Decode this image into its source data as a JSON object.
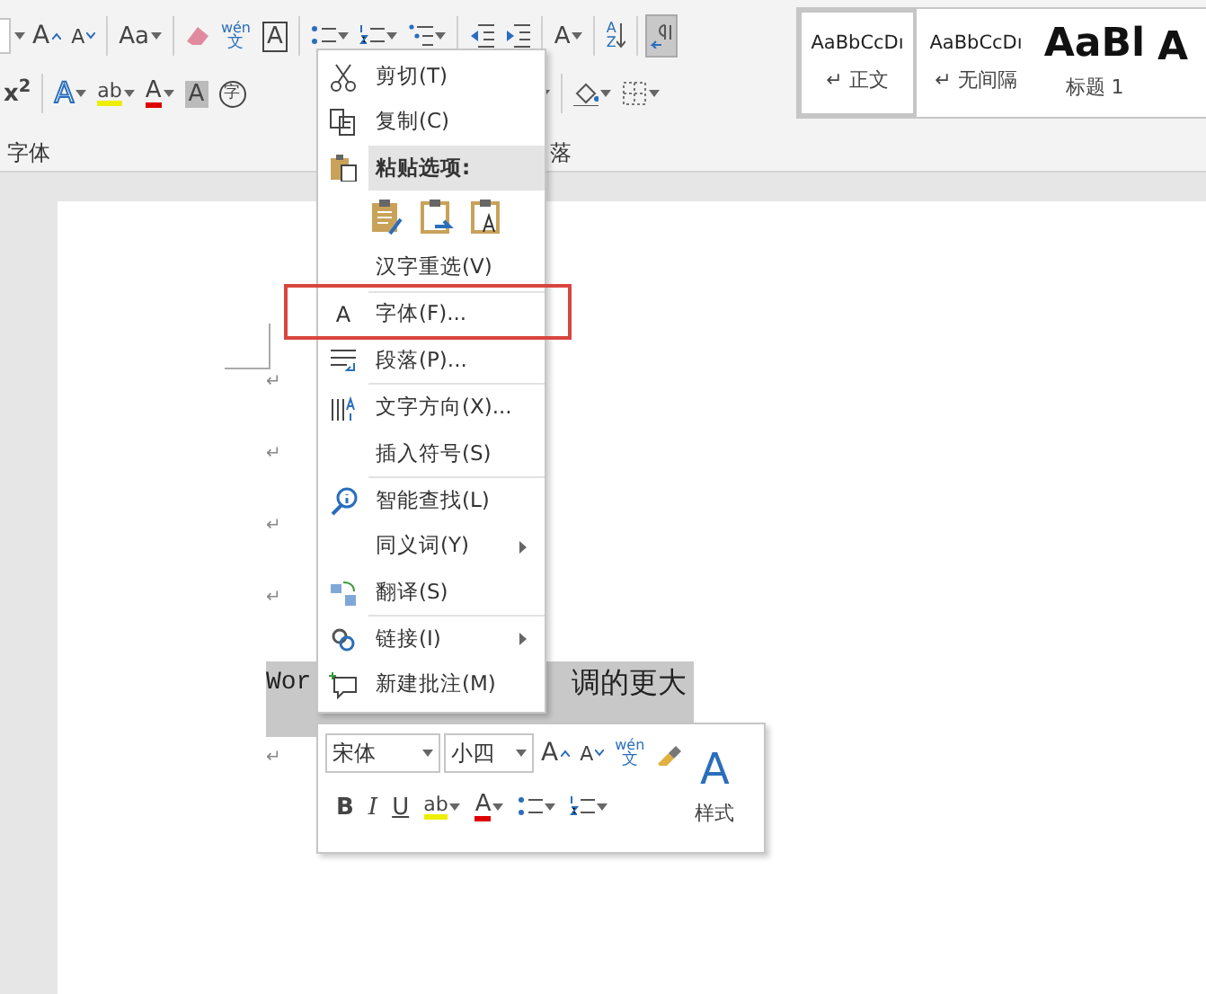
{
  "ribbon": {
    "row_1_labels": [
      "A",
      "A",
      "Aa",
      "wén",
      "文",
      "A",
      "A",
      "AZ"
    ],
    "row_2_labels": [
      "x$^{2}$",
      "A",
      "ab",
      "A",
      "A",
      "字"
    ],
    "show_marks_button": {
      "selected": true
    },
    "group_labels": [
      "字体",
      "落"
    ],
    "styles": [
      {
        "sample": "AaBbCcDı",
        "name": "↵ 正文",
        "kind": "normal",
        "selected": true
      },
      {
        "sample": "AaBbCcDı",
        "name": "↵ 无间隔",
        "kind": "normal",
        "selected": false
      },
      {
        "sample": "AaBl",
        "name": "标题 1",
        "kind": "heading",
        "selected": false
      },
      {
        "sample": "A",
        "kind": "heading",
        "selected": false
      }
    ]
  },
  "document": {
    "paragraph_marks": [
      "↵",
      "↵",
      "↵",
      "↵"
    ],
    "selected_text": [
      "Wor",
      "调的更大"
    ],
    "after_mark": "↵"
  },
  "context_menu": {
    "items": [
      {
        "kind": "item",
        "label": "剪切(T)"
      },
      {
        "kind": "item",
        "label": "复制(C)"
      },
      {
        "kind": "header",
        "label": "粘贴选项:"
      },
      {
        "kind": "paste-options"
      },
      {
        "kind": "item",
        "label": "汉字重选(V)",
        "separator_after": true
      },
      {
        "kind": "item",
        "glyph": "A",
        "label": "字体(F)...",
        "highlighted": true
      },
      {
        "kind": "item",
        "label": "段落(P)...",
        "separator_after": true
      },
      {
        "kind": "item",
        "label": "文字方向(X)..."
      },
      {
        "kind": "item",
        "label": "插入符号(S)",
        "separator_after": true
      },
      {
        "kind": "item",
        "label": "智能查找(L)"
      },
      {
        "kind": "item",
        "label": "同义词(Y)",
        "submenu": true
      },
      {
        "kind": "item",
        "label": "翻译(S)",
        "separator_after": true
      },
      {
        "kind": "item",
        "label": "链接(I)",
        "submenu": true
      },
      {
        "kind": "item",
        "label": "新建批注(M)"
      }
    ]
  },
  "mini_toolbar": {
    "font": "宋体",
    "size": "小四",
    "row_1_labels": [
      "A",
      "A",
      "wén",
      "文"
    ],
    "row_2_labels": [
      "B",
      "I",
      "U",
      "ab",
      "A"
    ],
    "styles_button": {
      "glyph": "A",
      "label": "样式"
    }
  }
}
